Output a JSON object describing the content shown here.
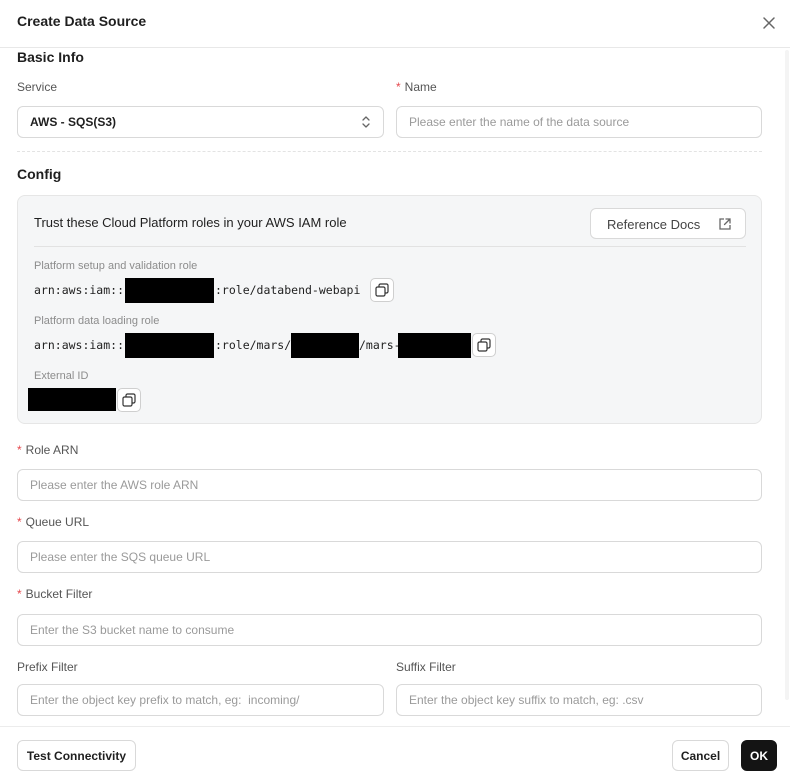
{
  "modal": {
    "title": "Create Data Source"
  },
  "basic_info": {
    "title": "Basic Info",
    "service_label": "Service",
    "service_value": "AWS - SQS(S3)",
    "name_label": "Name",
    "name_placeholder": "Please enter the name of the data source"
  },
  "config": {
    "title": "Config",
    "trust_text": "Trust these Cloud Platform roles in your AWS IAM role",
    "reference_docs_label": "Reference Docs",
    "setup_role_label": "Platform setup and validation role",
    "setup_role_prefix": "arn:aws:iam::",
    "setup_role_suffix": ":role/databend-webapi",
    "loading_role_label": "Platform data loading role",
    "loading_role_prefix": "arn:aws:iam::",
    "loading_role_mid": ":role/mars/",
    "loading_role_mid2": "/mars-",
    "external_id_label": "External ID"
  },
  "form": {
    "role_arn_label": "Role ARN",
    "role_arn_placeholder": "Please enter the AWS role ARN",
    "queue_url_label": "Queue URL",
    "queue_url_placeholder": "Please enter the SQS queue URL",
    "bucket_filter_label": "Bucket Filter",
    "bucket_filter_placeholder": "Enter the S3 bucket name to consume",
    "prefix_filter_label": "Prefix Filter",
    "prefix_filter_placeholder": "Enter the object key prefix to match, eg:  incoming/",
    "suffix_filter_label": "Suffix Filter",
    "suffix_filter_placeholder": "Enter the object key suffix to match, eg: .csv",
    "required_marker": "*"
  },
  "footer": {
    "test_label": "Test Connectivity",
    "cancel_label": "Cancel",
    "ok_label": "OK"
  },
  "icons": [
    "close-icon",
    "select-arrows-icon",
    "external-link-icon",
    "copy-icon"
  ],
  "colors": {
    "primary": "#141414",
    "required": "#e5484d",
    "border": "#d9d9d9",
    "panel": "#f5f6f7"
  }
}
